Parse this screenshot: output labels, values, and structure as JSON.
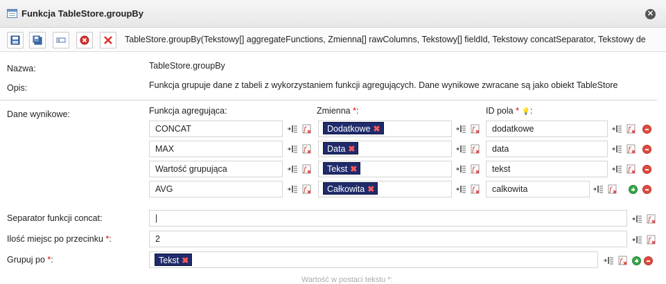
{
  "window": {
    "title": "Funkcja TableStore.groupBy",
    "close_icon": "close-icon"
  },
  "toolbar": {
    "signature": "TableStore.groupBy(Tekstowy[] aggregateFunctions, Zmienna[] rawColumns, Tekstowy[] fieldId, Tekstowy concatSeparator, Tekstowy de"
  },
  "info": {
    "name_label": "Nazwa:",
    "name_value": "TableStore.groupBy",
    "desc_label": "Opis:",
    "desc_value": "Funkcja grupuje dane z tabeli z wykorzystaniem funkcji agregujących. Dane wynikowe zwracane są jako obiekt TableStore"
  },
  "output": {
    "label": "Dane wynikowe:",
    "col1_header": "Funkcja agregująca:",
    "col2_header": "Zmienna",
    "col3_header": "ID pola",
    "colon": ":",
    "required_mark": "*",
    "rows": [
      {
        "func": "CONCAT",
        "var": "Dodatkowe",
        "id": "dodatkowe"
      },
      {
        "func": "MAX",
        "var": "Data",
        "id": "data"
      },
      {
        "func": "Wartość grupująca",
        "var": "Tekst",
        "id": "tekst"
      },
      {
        "func": "AVG",
        "var": "Całkowita",
        "id": "calkowita"
      }
    ]
  },
  "params": {
    "concat_label": "Separator funkcji concat:",
    "concat_value": "|",
    "decimal_label": "Ilość miejsc po przecinku",
    "decimal_value": "2",
    "groupby_label": "Grupuj po",
    "groupby_tag": "Tekst"
  },
  "footer_fragment": "Wartość w postaci tekstu *:",
  "colors": {
    "accent": "#1f2b6b",
    "required": "#dd0000",
    "delete": "#e04b3f",
    "add": "#3aa64a"
  }
}
